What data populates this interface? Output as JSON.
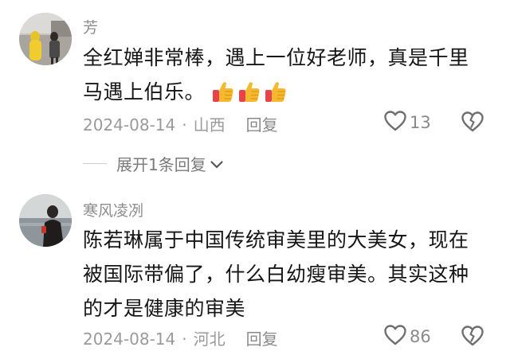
{
  "comments": [
    {
      "username": "芳",
      "text_lines": [
        "全红婵非常棒，遇上一位好老师，真是千里",
        "马遇上伯乐。"
      ],
      "emoji_icon": "thumbs-up-emoji",
      "emoji_count": 3,
      "date": "2024-08-14",
      "separator": "·",
      "location": "山西",
      "reply_label": "回复",
      "like_count": "13"
    },
    {
      "username": "寒风凌冽",
      "text_lines": [
        "陈若琳属于中国传统审美里的大美女，现在",
        "被国际带偏了，什么白幼瘦审美。其实这种",
        "的才是健康的审美"
      ],
      "date": "2024-08-14",
      "separator": "·",
      "location": "河北",
      "reply_label": "回复",
      "like_count": "86"
    }
  ],
  "expand_replies": {
    "label": "展开1条回复",
    "icon": "chevron-down-icon"
  },
  "colors": {
    "text": "#161616",
    "muted": "#8c8c8c",
    "thumb": "#f5b82e",
    "cuff": "#e8434b"
  }
}
